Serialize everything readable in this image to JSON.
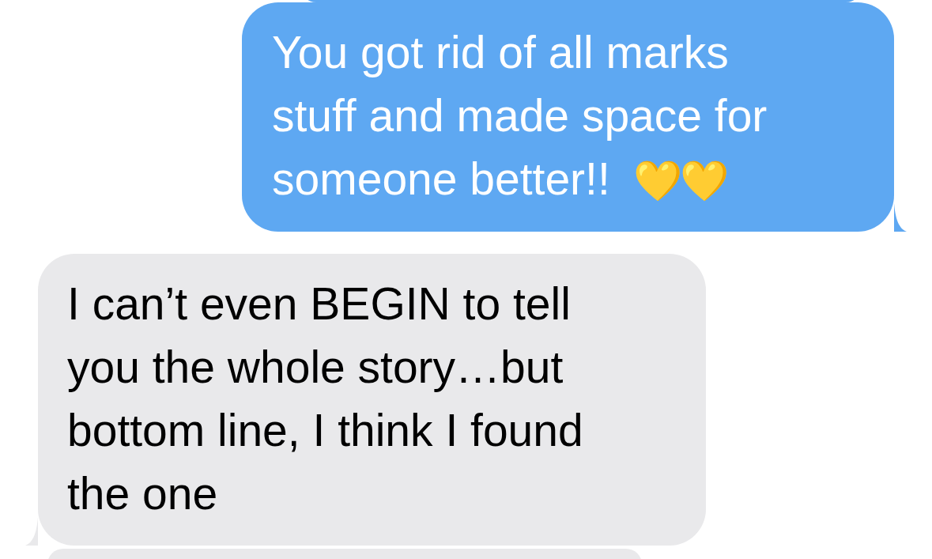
{
  "messages": [
    {
      "kind": "sent_partial"
    },
    {
      "kind": "sent",
      "lines": [
        "You got rid of all marks",
        "stuff and made space for",
        "someone better!!"
      ],
      "emoji": "💛💛"
    },
    {
      "kind": "received",
      "lines": [
        "I can’t even BEGIN to tell",
        "you the whole story…but",
        "bottom line, I think I found",
        "the one"
      ]
    },
    {
      "kind": "received_partial"
    }
  ]
}
